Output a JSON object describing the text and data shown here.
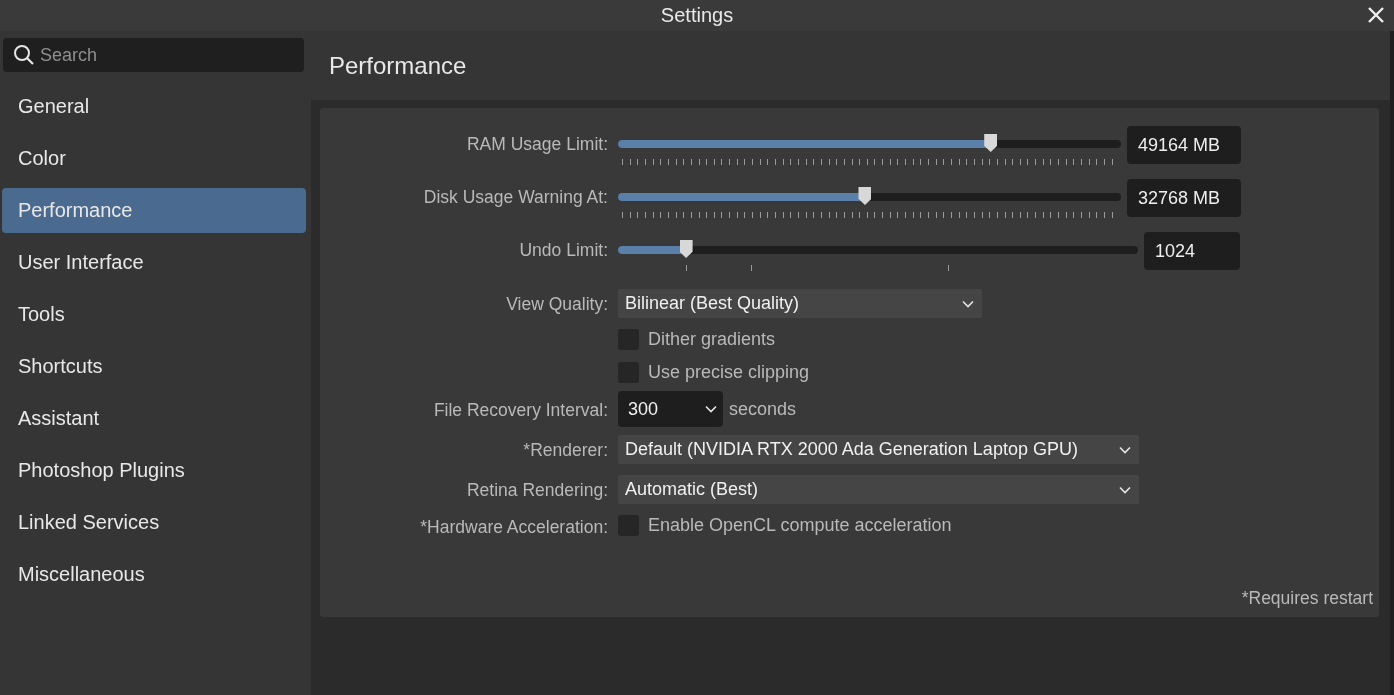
{
  "window": {
    "title": "Settings"
  },
  "search": {
    "placeholder": "Search"
  },
  "sidebar": {
    "items": [
      {
        "label": "General",
        "selected": false
      },
      {
        "label": "Color",
        "selected": false
      },
      {
        "label": "Performance",
        "selected": true
      },
      {
        "label": "User Interface",
        "selected": false
      },
      {
        "label": "Tools",
        "selected": false
      },
      {
        "label": "Shortcuts",
        "selected": false
      },
      {
        "label": "Assistant",
        "selected": false
      },
      {
        "label": "Photoshop Plugins",
        "selected": false
      },
      {
        "label": "Linked Services",
        "selected": false
      },
      {
        "label": "Miscellaneous",
        "selected": false
      }
    ]
  },
  "page": {
    "title": "Performance"
  },
  "settings": [
    {
      "kind": "slider",
      "label": "RAM Usage Limit:",
      "level": 0.74,
      "value": "49164 MB"
    },
    {
      "kind": "slider",
      "label": "Disk Usage Warning At:",
      "level": 0.49,
      "value": "32768 MB"
    },
    {
      "kind": "slider",
      "label": "Undo Limit:",
      "level": 0.13,
      "value": "1024"
    },
    {
      "kind": "dropdown",
      "label": "View Quality:",
      "value": "Bilinear (Best Quality)"
    },
    {
      "kind": "checkbox",
      "text": "Dither gradients",
      "checked": false
    },
    {
      "kind": "checkbox",
      "text": "Use precise clipping",
      "checked": false
    },
    {
      "kind": "dropdown",
      "label": "File Recovery Interval:",
      "value": "300",
      "suffix": "seconds"
    },
    {
      "kind": "dropdown",
      "label": "*Renderer:",
      "value": "Default (NVIDIA RTX 2000 Ada Generation Laptop GPU)"
    },
    {
      "kind": "dropdown",
      "label": "Retina Rendering:",
      "value": "Automatic (Best)"
    },
    {
      "kind": "checkbox",
      "label": "*Hardware Acceleration:",
      "text": "Enable OpenCL compute acceleration",
      "checked": false
    }
  ],
  "footnote": "*Requires restart"
}
